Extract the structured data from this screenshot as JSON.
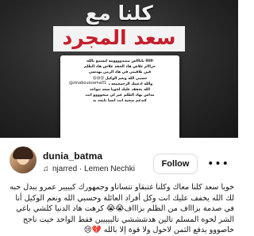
{
  "image": {
    "headline_line1": "كلنا مع",
    "headline_line2": "سعد المجرد",
    "story_text": "اااااا ياناااس مصدوووومة لتسمع بالله\nحرااام علاش هاد الحقد علاش هاد الظلم\nفين تلاقيتي في هاد الزمن بهدشي\nحسبي الله ونعم الوكيل 😢😢😢\nوالله ادعمك الرحمعمعه من هاد الدنيا\nالله يخفف عليك لخويا سعد نتواحد\nمداس بهاد الظلم غير لي ميحوووو انت\nكتدعم ضحية انت انسا تايجد يد",
    "story_tag": "@zinaboussama01"
  },
  "post": {
    "username": "dunia_batma",
    "audio_icon": "music-note-icon",
    "audio_text": "njarred · Lemen Nechki",
    "follow_label": "Follow",
    "more_icon": "more-dots-icon",
    "caption": "خويا سعد كلنا معاك وكلنا غتبقاو تتساناو وجمهورك كبييير عمرو يبدل حبه لك الله يخفف عليك انت وكل أفراد العائلة وحسبي الله ونعم الوكيل أنا في صدمة بزاااف من الظلم بزاااف😭😭 كرهت هاد الدنيا كلشي باغي الشر لخوه المسلم تالين هدشششي تالييييين فقط الواحد حيت ناجح خاصووو يدفع الثمن لاحول ولا قوة إلا بالله 💔😢"
  }
}
